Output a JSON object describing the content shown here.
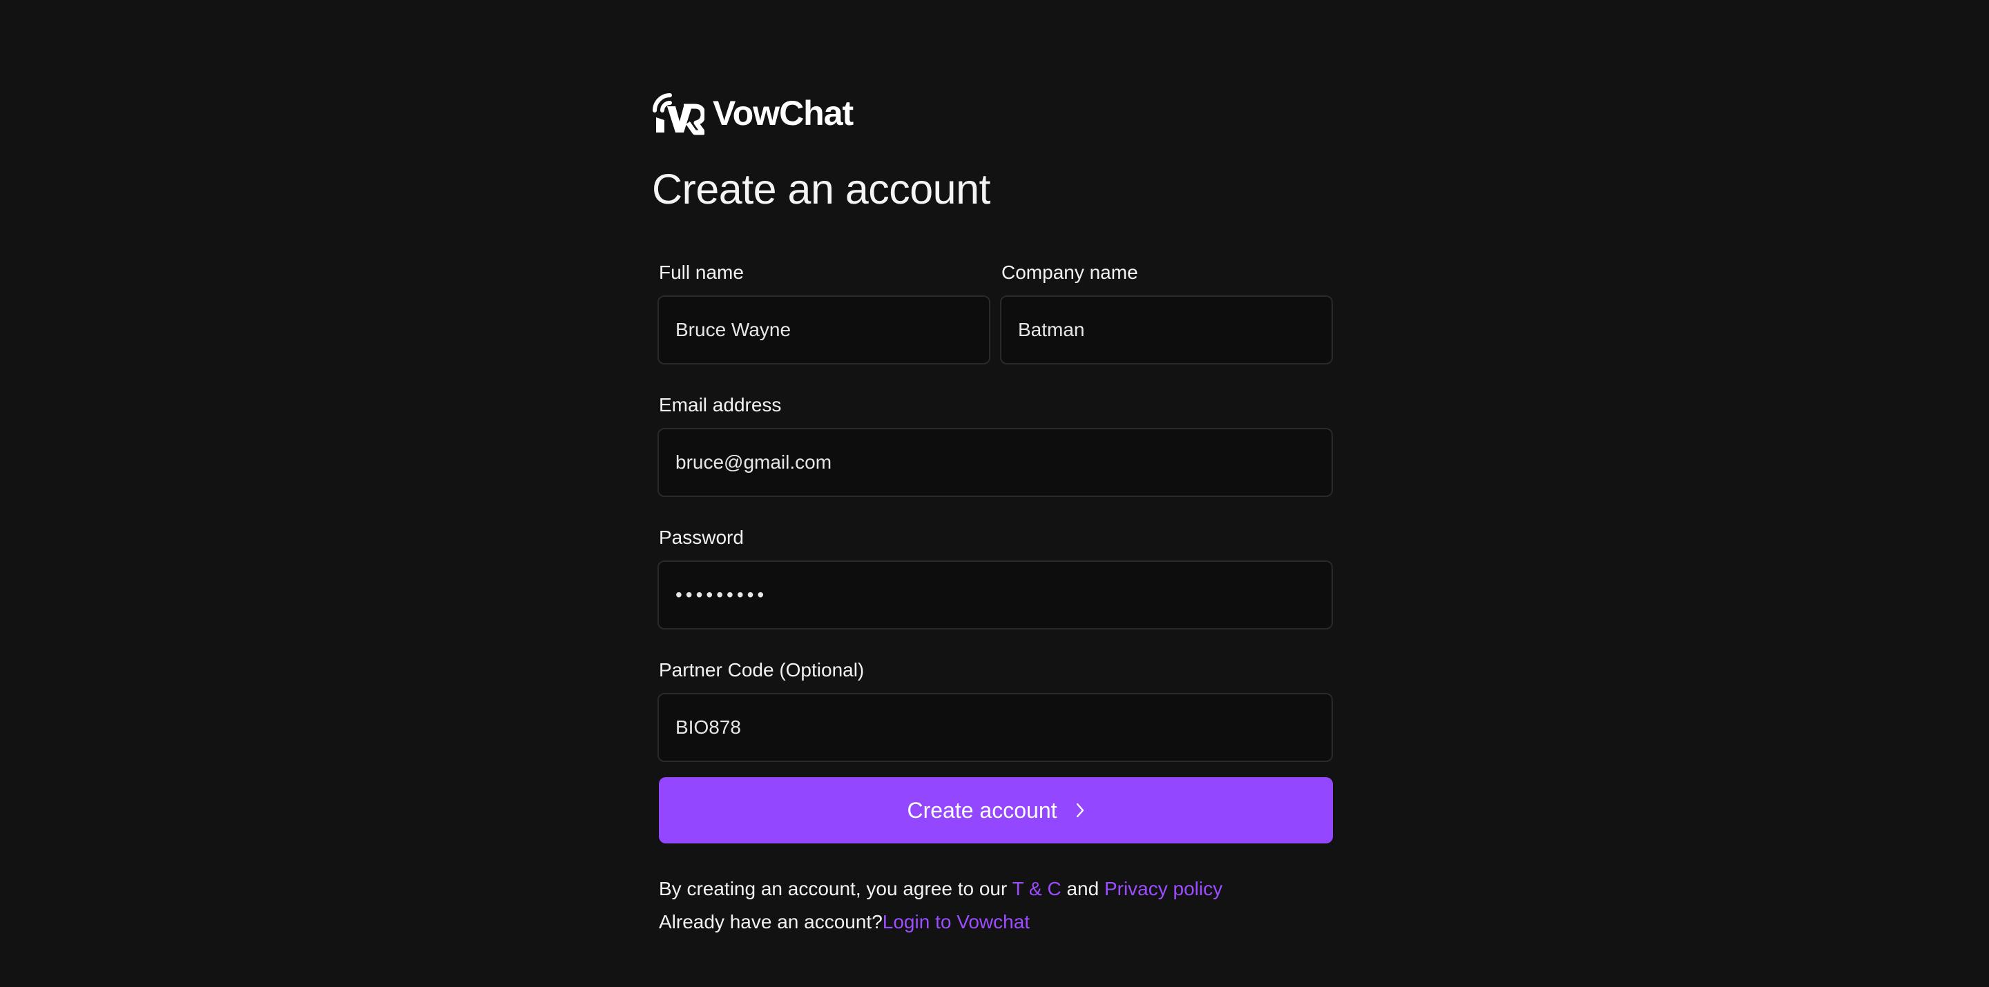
{
  "brand": {
    "name": "VowChat",
    "accent": "#9347fe",
    "link_color": "#9b4dff",
    "background": "#121212"
  },
  "page": {
    "title": "Create an account"
  },
  "form": {
    "full_name": {
      "label": "Full name",
      "value": "Bruce Wayne"
    },
    "company_name": {
      "label": "Company name",
      "value": "Batman"
    },
    "email": {
      "label": "Email address",
      "value": "bruce@gmail.com"
    },
    "password": {
      "label": "Password",
      "value": "•••••••••"
    },
    "partner_code": {
      "label": "Partner Code (Optional)",
      "value": "BIO878"
    },
    "submit": {
      "label": "Create account",
      "icon": "chevron-right-icon"
    }
  },
  "legal": {
    "agree_prefix": "By creating an account, you agree to our",
    "terms_link": "T & C",
    "and": "and",
    "privacy_link": "Privacy policy",
    "login_prompt": "Already have an account?",
    "login_link": "Login to Vowchat"
  }
}
